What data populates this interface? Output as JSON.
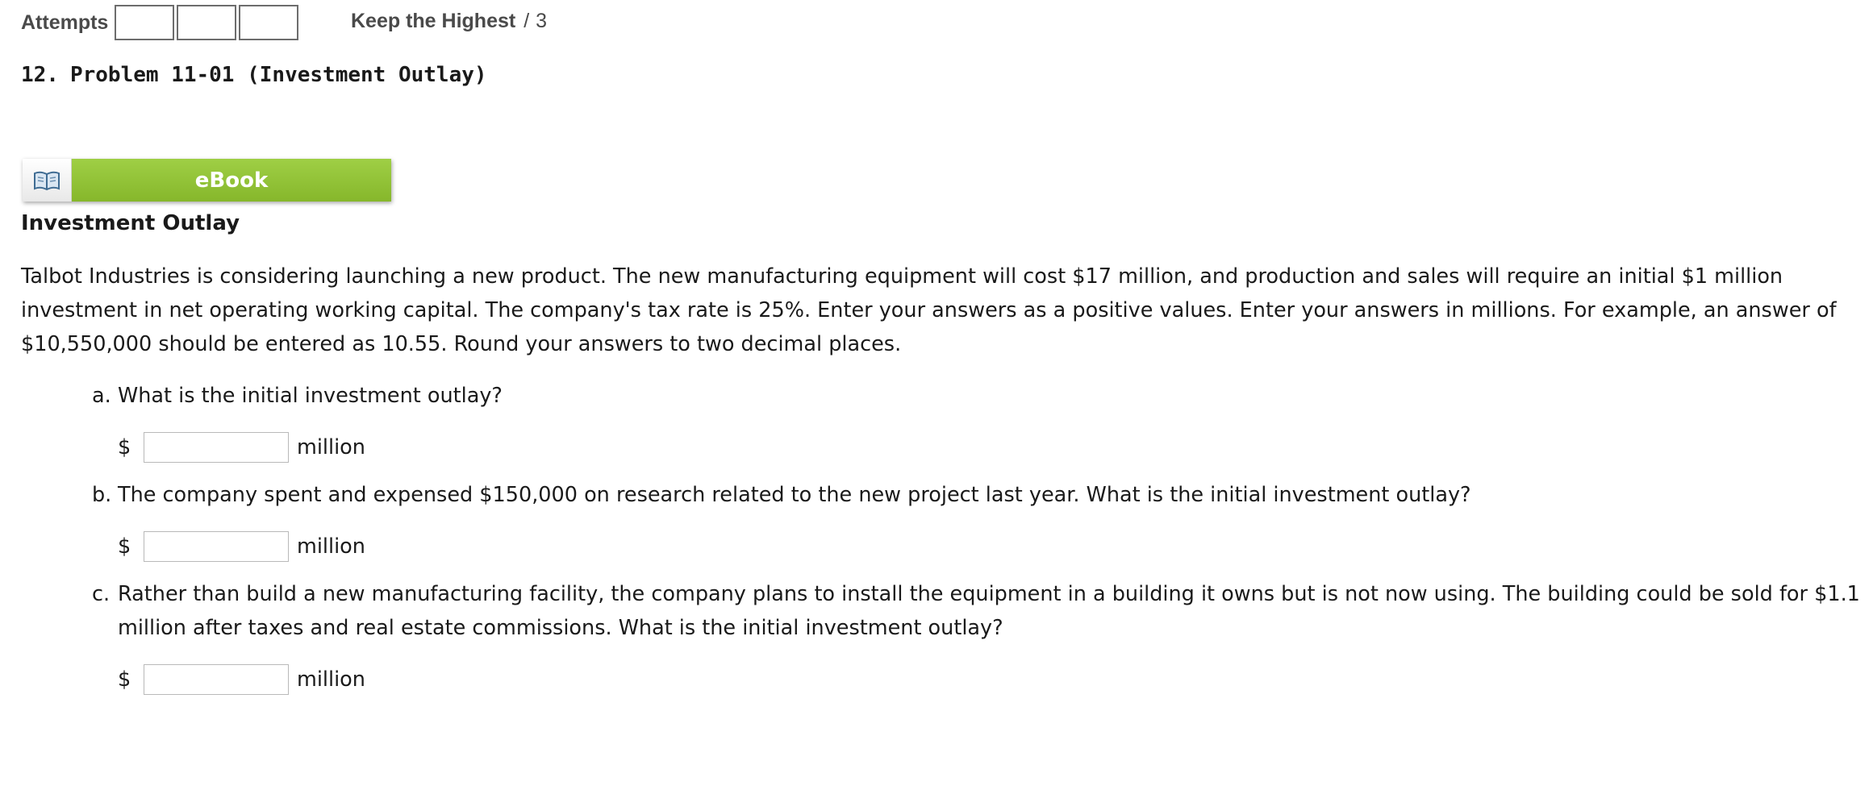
{
  "header": {
    "attempts_label": "Attempts",
    "attempt_boxes": 3,
    "keep_highest_label": "Keep the Highest",
    "slash": "/",
    "max_attempts": "3"
  },
  "problem": {
    "number": "12.",
    "title": "Problem 11-01 (Investment Outlay)"
  },
  "ebook": {
    "label": "eBook",
    "icon": "open-book-icon",
    "accent_color": "#8dc63f"
  },
  "section": {
    "heading": "Investment Outlay",
    "intro": "Talbot Industries is considering launching a new product. The new manufacturing equipment will cost $17 million, and production and sales will require an initial $1 million investment in net operating working capital. The company's tax rate is 25%. Enter your answers as a positive values. Enter your answers in millions. For example, an answer of $10,550,000 should be entered as 10.55. Round your answers to two decimal places."
  },
  "questions": [
    {
      "letter": "a.",
      "text": "What is the initial investment outlay?",
      "currency": "$",
      "value": "",
      "unit": "million"
    },
    {
      "letter": "b.",
      "text": "The company spent and expensed $150,000 on research related to the new project last year. What is the initial investment outlay?",
      "currency": "$",
      "value": "",
      "unit": "million"
    },
    {
      "letter": "c.",
      "text": "Rather than build a new manufacturing facility, the company plans to install the equipment in a building it owns but is not now using. The building could be sold for $1.1 million after taxes and real estate commissions. What is the initial investment outlay?",
      "currency": "$",
      "value": "",
      "unit": "million"
    }
  ]
}
